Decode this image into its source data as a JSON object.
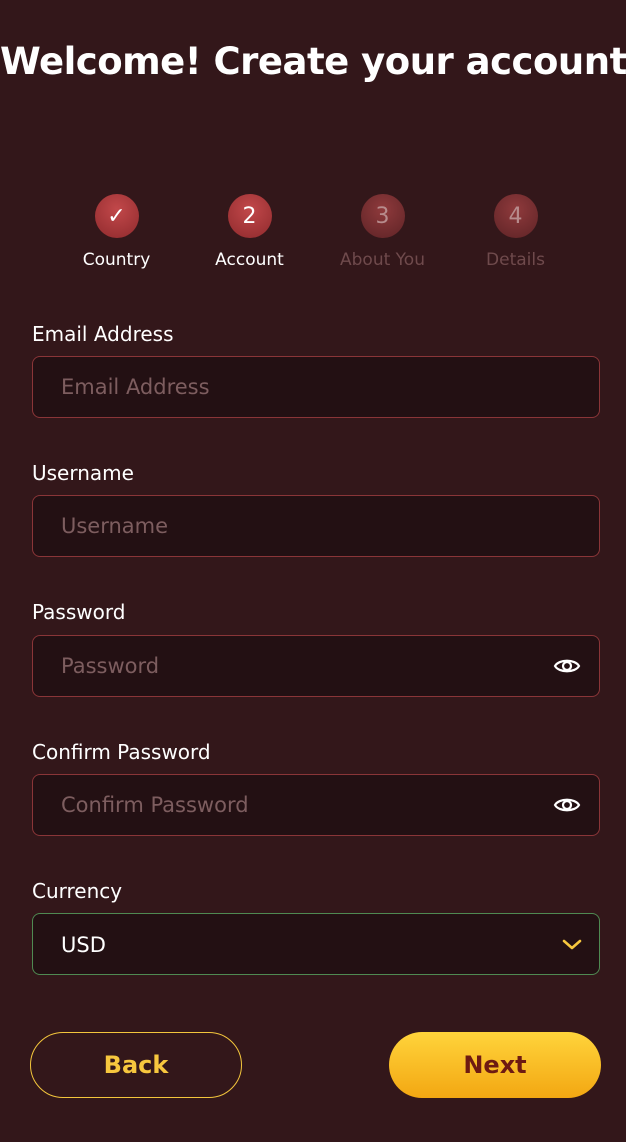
{
  "title": "Welcome! Create your account.",
  "steps": [
    {
      "indicator": "✓",
      "label": "Country",
      "state": "completed"
    },
    {
      "indicator": "2",
      "label": "Account",
      "state": "active"
    },
    {
      "indicator": "3",
      "label": "About You",
      "state": "inactive"
    },
    {
      "indicator": "4",
      "label": "Details",
      "state": "inactive"
    }
  ],
  "form": {
    "email": {
      "label": "Email Address",
      "placeholder": "Email Address",
      "value": ""
    },
    "username": {
      "label": "Username",
      "placeholder": "Username",
      "value": ""
    },
    "password": {
      "label": "Password",
      "placeholder": "Password",
      "value": "",
      "toggle_icon": "eye-icon"
    },
    "confirm_password": {
      "label": "Confirm Password",
      "placeholder": "Confirm Password",
      "value": "",
      "toggle_icon": "eye-icon"
    },
    "currency": {
      "label": "Currency",
      "selected": "USD",
      "icon": "chevron-down-icon"
    }
  },
  "buttons": {
    "back": "Back",
    "next": "Next"
  },
  "colors": {
    "background": "#33171a",
    "field_border": "#8a3538",
    "select_border": "#4f8a52",
    "accent_yellow": "#f7c73e",
    "step_circle": "#b23c3f"
  }
}
